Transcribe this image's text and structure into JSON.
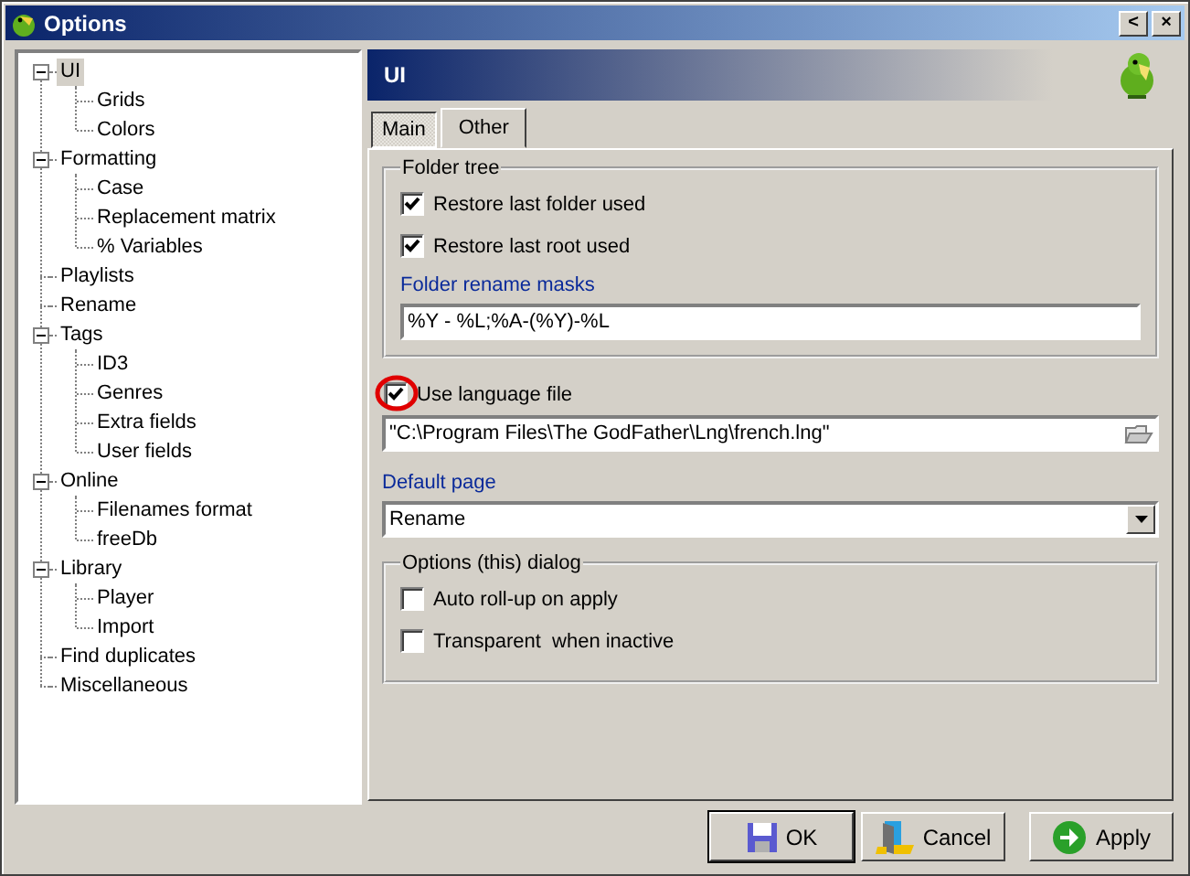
{
  "window": {
    "title": "Options"
  },
  "title_buttons": [
    {
      "label": "<"
    },
    {
      "label": "×"
    }
  ],
  "tree": [
    {
      "label": "UI",
      "selected": true,
      "expanded": true,
      "children": [
        {
          "label": "Grids",
          "selected": false
        },
        {
          "label": "Colors",
          "selected": false
        }
      ]
    },
    {
      "label": "Formatting",
      "selected": false,
      "expanded": true,
      "children": [
        {
          "label": "Case",
          "selected": false
        },
        {
          "label": "Replacement matrix",
          "selected": false
        },
        {
          "label": "% Variables",
          "selected": false
        }
      ]
    },
    {
      "label": "Playlists",
      "selected": false
    },
    {
      "label": "Rename",
      "selected": false
    },
    {
      "label": "Tags",
      "selected": false,
      "expanded": true,
      "children": [
        {
          "label": "ID3",
          "selected": false
        },
        {
          "label": "Genres",
          "selected": false
        },
        {
          "label": "Extra fields",
          "selected": false
        },
        {
          "label": "User fields",
          "selected": false
        }
      ]
    },
    {
      "label": "Online",
      "selected": false,
      "expanded": true,
      "children": [
        {
          "label": "Filenames format",
          "selected": false
        },
        {
          "label": "freeDb",
          "selected": false
        }
      ]
    },
    {
      "label": "Library",
      "selected": false,
      "expanded": true,
      "children": [
        {
          "label": "Player",
          "selected": false
        },
        {
          "label": "Import",
          "selected": false
        }
      ]
    },
    {
      "label": "Find duplicates",
      "selected": false
    },
    {
      "label": "Miscellaneous",
      "selected": false
    }
  ],
  "panel": {
    "title": "UI"
  },
  "tabs": [
    {
      "label": "Main",
      "selected": true
    },
    {
      "label": "Other",
      "selected": false
    }
  ],
  "folder_tree": {
    "title": "Folder tree",
    "options": [
      {
        "label": "Restore last folder used",
        "checked": true
      },
      {
        "label": "Restore last root used",
        "checked": true
      }
    ],
    "masks_label": "Folder rename masks",
    "masks_value": "%Y - %L;%A-(%Y)-%L"
  },
  "language": {
    "label": "Use language file",
    "checked": true,
    "highlighted": true,
    "path": "\"C:\\Program Files\\The GodFather\\Lng\\french.lng\""
  },
  "default_page": {
    "label": "Default page",
    "value": "Rename"
  },
  "dialog_options": {
    "title": "Options (this) dialog",
    "options": [
      {
        "label": "Auto roll-up on apply",
        "checked": false
      },
      {
        "label": "Transparent  when inactive",
        "checked": false
      }
    ]
  },
  "buttons": [
    {
      "label": "OK",
      "kind": "ok",
      "default": true
    },
    {
      "label": "Cancel",
      "kind": "cancel",
      "default": false
    },
    {
      "label": "Apply",
      "kind": "apply",
      "default": false
    }
  ]
}
